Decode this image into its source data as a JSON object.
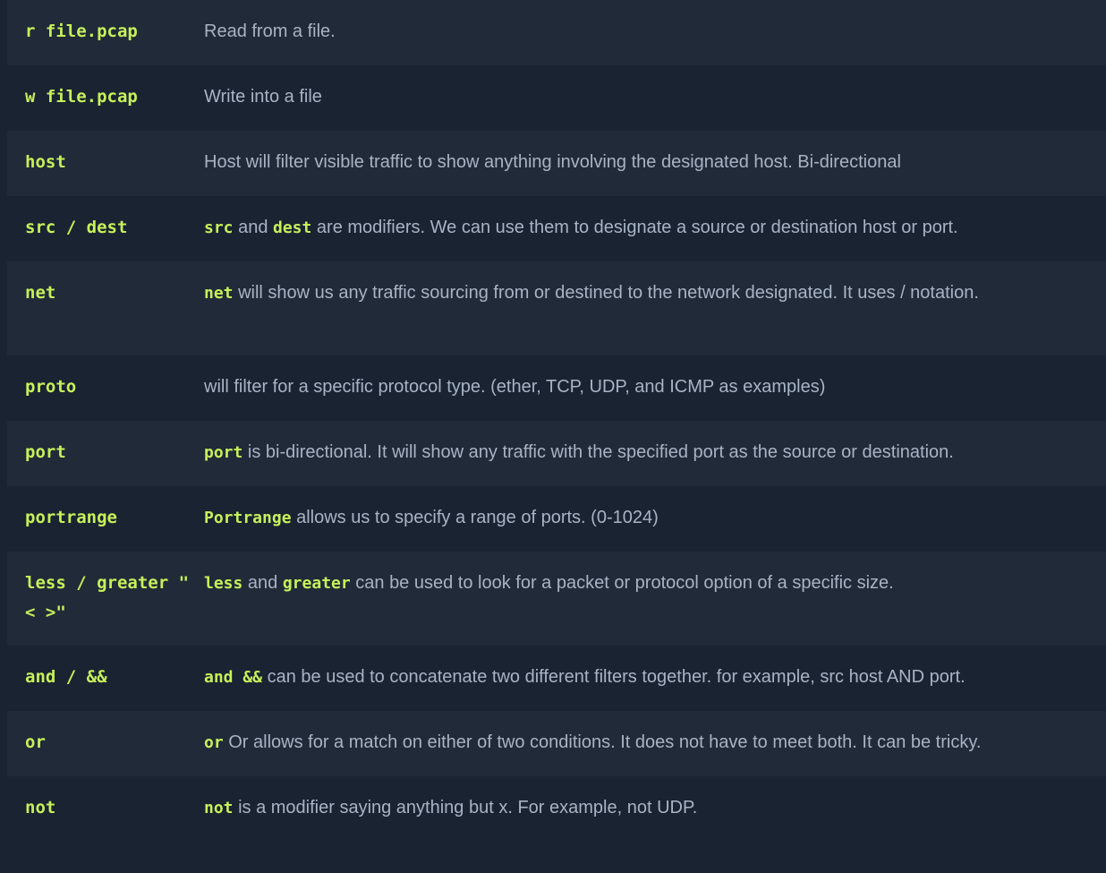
{
  "rows": [
    {
      "cmd": "r file.pcap",
      "code1": "",
      "mid": "",
      "code2": "",
      "text": "Read from a file."
    },
    {
      "cmd": "w file.pcap",
      "code1": "",
      "mid": "",
      "code2": "",
      "text": "Write into a file"
    },
    {
      "cmd": "host",
      "code1": "",
      "mid": "",
      "code2": "",
      "text": "Host will filter visible traffic to show anything involving the designated host. Bi-directional"
    },
    {
      "cmd": "src / dest",
      "code1": "src",
      "mid": " and ",
      "code2": "dest",
      "text": " are modifiers. We can use them to designate a source or destination host or port."
    },
    {
      "cmd": "net",
      "code1": "net",
      "mid": "",
      "code2": "",
      "text": " will show us any traffic sourcing from or destined to the network designated. It uses / notation."
    },
    {
      "cmd": "proto",
      "code1": "",
      "mid": "",
      "code2": "",
      "text": "will filter for a specific protocol type. (ether, TCP, UDP, and ICMP as examples)"
    },
    {
      "cmd": "port",
      "code1": "port",
      "mid": "",
      "code2": "",
      "text": " is bi-directional. It will show any traffic with the specified port as the source or destination."
    },
    {
      "cmd": "portrange",
      "code1": "Portrange",
      "mid": "",
      "code2": "",
      "text": " allows us to specify a range of ports. (0-1024)"
    },
    {
      "cmd": "less / greater \" < >\"",
      "code1": "less",
      "mid": " and ",
      "code2": "greater",
      "text": " can be used to look for a packet or protocol option of a specific size."
    },
    {
      "cmd": "and / &&",
      "code1": "and &&",
      "mid": "",
      "code2": "",
      "text": " can be used to concatenate two different filters together. for example, src host AND port."
    },
    {
      "cmd": "or",
      "code1": "or",
      "mid": "",
      "code2": "",
      "text": " Or allows for a match on either of two conditions. It does not have to meet both. It can be tricky."
    },
    {
      "cmd": "not",
      "code1": "not",
      "mid": "",
      "code2": "",
      "text": " is a modifier saying anything but x. For example, not UDP."
    }
  ]
}
